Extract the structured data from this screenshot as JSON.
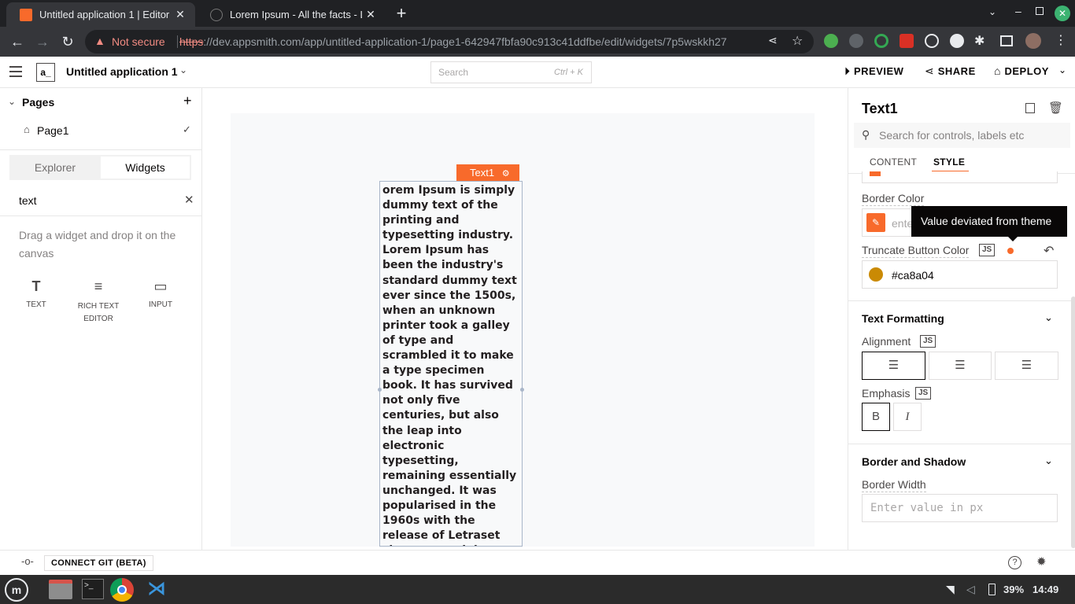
{
  "browser": {
    "tabs": [
      {
        "title": "Untitled application 1 | Editor",
        "active": true
      },
      {
        "title": "Lorem Ipsum - All the facts - L",
        "active": false
      }
    ],
    "security_label": "Not secure",
    "url_scheme": "https",
    "url_rest": "://dev.appsmith.com/app/untitled-application-1/page1-642947fbfa90c913c41ddfbe/edit/widgets/7p5wskkh27"
  },
  "header": {
    "logo_text": "a_",
    "app_name": "Untitled application 1",
    "search_placeholder": "Search",
    "search_shortcut": "Ctrl + K",
    "preview_label": "PREVIEW",
    "share_label": "SHARE",
    "deploy_label": "DEPLOY"
  },
  "sidebar": {
    "pages_title": "Pages",
    "page_name": "Page1",
    "tabs": [
      "Explorer",
      "Widgets"
    ],
    "widget_search_value": "text",
    "drag_hint": "Drag a widget and drop it on the canvas",
    "widgets": [
      {
        "label": "TEXT",
        "icon": "T"
      },
      {
        "label": "RICH TEXT EDITOR",
        "icon": "≡"
      },
      {
        "label": "INPUT",
        "icon": "▭"
      }
    ]
  },
  "canvas": {
    "widget_tag": "Text1",
    "text": "orem Ipsum is simply dummy text of the printing and typesetting industry. Lorem Ipsum has been the industry's standard dummy text ever since the 1500s, when an unknown printer took a galley of type and scrambled it to make a type specimen book. It has survived not only five centuries, but also the leap into electronic typesetting, remaining essentially unchanged. It was popularised in the 1960s with the release of Letraset sheets containing Lorem Ipsum passages, and more recently with desktop publishing"
  },
  "properties": {
    "widget_name": "Text1",
    "search_placeholder": "Search for controls, labels etc",
    "tabs": [
      "CONTENT",
      "STYLE"
    ],
    "active_tab": "STYLE",
    "border_color_label": "Border Color",
    "border_color_placeholder": "enter",
    "tooltip": "Value deviated from theme",
    "truncate_label": "Truncate Button Color",
    "truncate_value": "#ca8a04",
    "js_label": "JS",
    "text_formatting_title": "Text Formatting",
    "alignment_label": "Alignment",
    "emphasis_label": "Emphasis",
    "bold_label": "B",
    "italic_label": "I",
    "border_shadow_title": "Border and Shadow",
    "border_width_label": "Border Width",
    "border_width_placeholder": "Enter value in px"
  },
  "bottom": {
    "git_label": "CONNECT GIT (BETA)"
  },
  "taskbar": {
    "battery": "39%",
    "time": "14:49"
  },
  "colors": {
    "accent": "#f86a2b",
    "truncate": "#ca8a04"
  }
}
